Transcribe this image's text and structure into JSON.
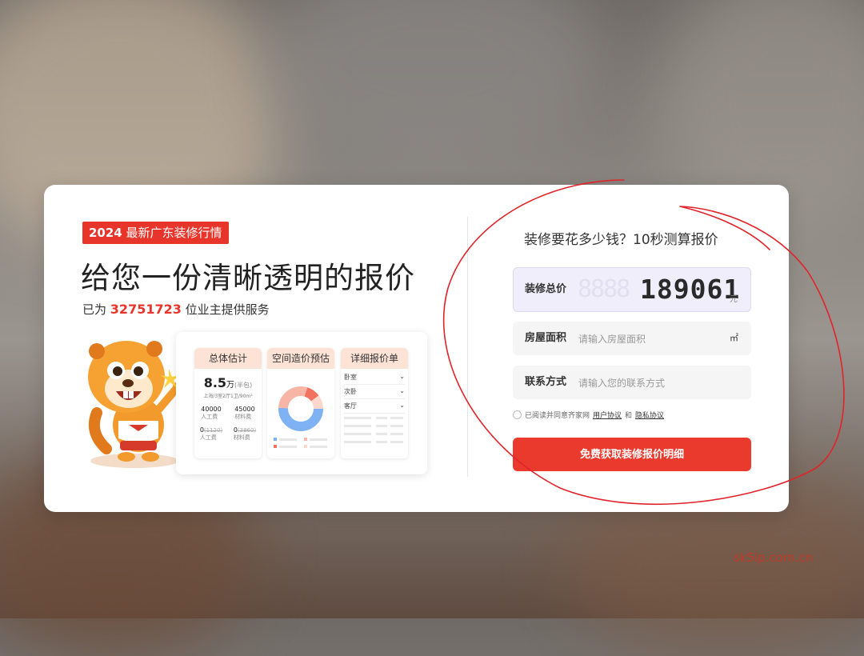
{
  "background": {
    "accent": "#e8352b"
  },
  "left": {
    "tag_year": "2024",
    "tag_text": "最新广东装修行情",
    "headline": "给您一份清晰透明的报价",
    "served_prefix": "已为",
    "served_count": "32751723",
    "served_suffix": "位业主提供服务"
  },
  "preview": {
    "estimate": {
      "header": "总体估计",
      "amount": "8.5",
      "unit": "万",
      "unit_note": "(半包)",
      "desc": "上海/3室2厅1卫/90m²",
      "labor_value": "40000",
      "labor_label": "人工费",
      "material_value": "45000",
      "material_label": "材料费",
      "labor2_value": "0",
      "labor2_old": "(1120)",
      "labor2_label": "人工费",
      "material2_value": "0",
      "material2_old": "(3860)",
      "material2_label": "材料费"
    },
    "space": {
      "header": "空间造价预估"
    },
    "detail": {
      "header": "详细报价单",
      "rows": [
        "卧室",
        "次卧",
        "客厅"
      ]
    }
  },
  "calc": {
    "title": "装修要花多少钱？10秒测算报价",
    "total_label": "装修总价",
    "total_bg_digits": "8888",
    "total_value": "189061",
    "total_unit": "元",
    "area_label": "房屋面积",
    "area_placeholder": "请输入房屋面积",
    "area_unit": "㎡",
    "contact_label": "联系方式",
    "contact_placeholder": "请输入您的联系方式",
    "agree_prefix": "已阅读并同意齐家网",
    "agree_link1": "用户协议",
    "agree_and": "和",
    "agree_link2": "隐私协议",
    "cta_label": "免费获取装修报价明细"
  },
  "watermark": "sk5lp.com.cn"
}
